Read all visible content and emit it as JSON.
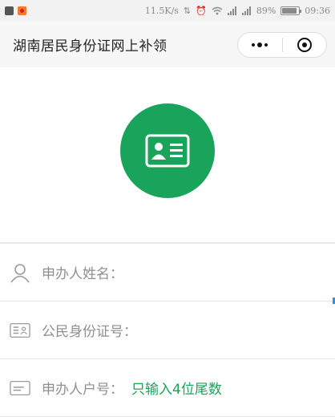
{
  "status_bar": {
    "speed": "11.5K/s",
    "battery_percent": "89%",
    "battery_level": 0.89,
    "time": "09:36"
  },
  "header": {
    "title": "湖南居民身份证网上补领",
    "menu_icon": "more-dots-icon",
    "close_icon": "target-circle-icon"
  },
  "hero": {
    "icon": "id-card-icon",
    "color": "#1aa35a"
  },
  "form": {
    "rows": [
      {
        "icon": "user-outline-icon",
        "label": "申办人姓名："
      },
      {
        "icon": "id-card-outline-icon",
        "label": "公民身份证号："
      },
      {
        "icon": "household-register-icon",
        "label": "申办人户号：",
        "hint": "只输入4位尾数"
      }
    ]
  },
  "colors": {
    "accent": "#1aa35a",
    "label": "#8f8f8f"
  }
}
